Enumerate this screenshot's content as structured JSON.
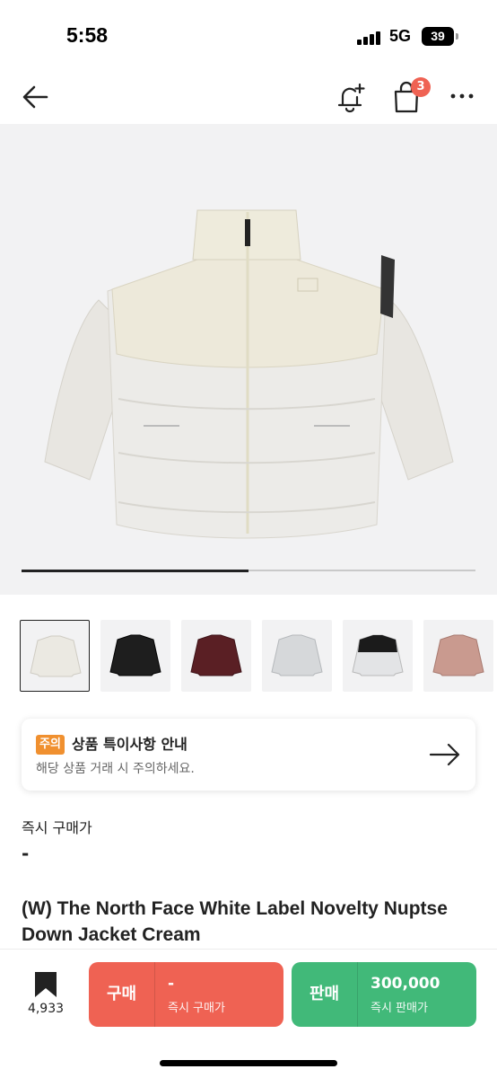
{
  "status_bar": {
    "time": "5:58",
    "network": "5G",
    "battery": "39"
  },
  "header": {
    "cart_count": "3"
  },
  "gallery": {
    "progress_fraction": 0.5,
    "thumbnail_colors": [
      "cream",
      "black",
      "burgundy",
      "silver",
      "black-white",
      "pink"
    ],
    "selected_index": 0
  },
  "notice": {
    "tag": "주의",
    "title": "상품 특이사항 안내",
    "description": "해당 상품 거래 시 주의하세요."
  },
  "price": {
    "label": "즉시 구매가",
    "value": "-"
  },
  "product": {
    "title": "(W) The North Face White Label Novelty Nuptse Down Jacket Cream"
  },
  "bottom_bar": {
    "wish_count": "4,933",
    "buy": {
      "label": "구매",
      "price": "-",
      "sub": "즉시 구매가"
    },
    "sell": {
      "label": "판매",
      "price": "300,000",
      "sub": "즉시 판매가"
    }
  },
  "colors": {
    "buy": "#ef6253",
    "sell": "#41b979",
    "notice_tag": "#f0902f",
    "badge": "#ef6253"
  },
  "icons": [
    "back-arrow-icon",
    "bell-plus-icon",
    "shopping-bag-icon",
    "more-icon",
    "arrow-right-icon",
    "bookmark-icon"
  ]
}
